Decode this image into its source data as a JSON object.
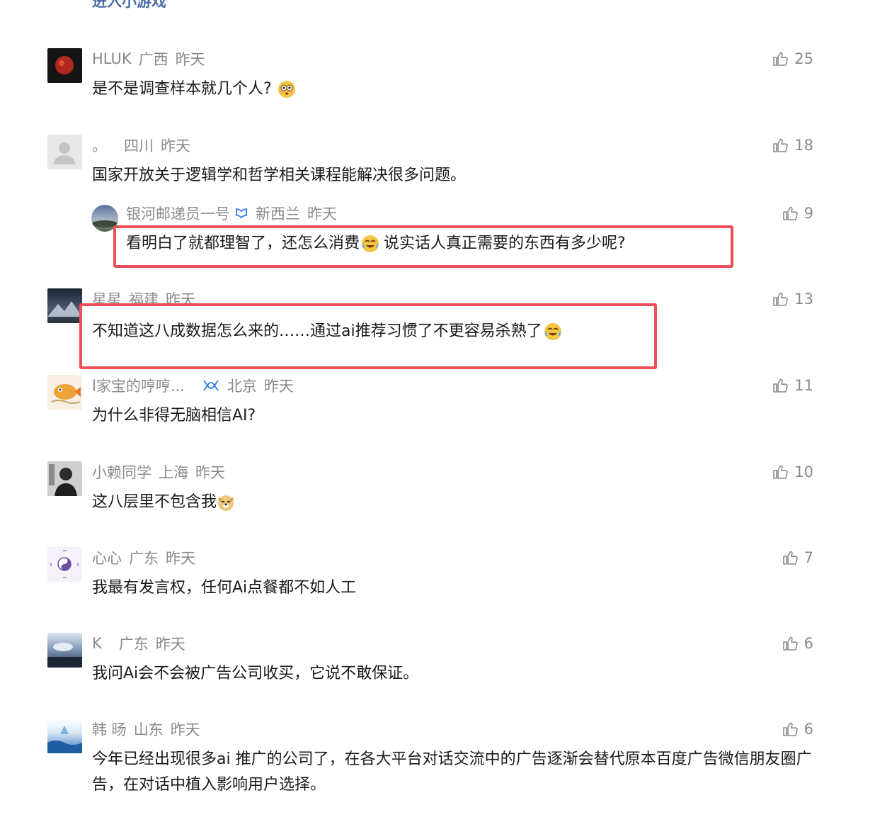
{
  "top_link": "进入小游戏",
  "comments": [
    {
      "user": "HLUK",
      "location": "广西",
      "time": "昨天",
      "likes": "25",
      "text": "是不是调查样本就几个人?",
      "emoji": "flushed"
    },
    {
      "user": "。",
      "location": "四川",
      "time": "昨天",
      "likes": "18",
      "text": "国家开放关于逻辑学和哲学相关课程能解决很多问题。"
    },
    {
      "user": "银河邮递员一号",
      "location": "新西兰",
      "time": "昨天",
      "likes": "9",
      "text_a": "看明白了就都理智了，还怎么消费",
      "text_b": "说实话人真正需要的东西有多少呢?",
      "emoji": "laugh-cry"
    },
    {
      "user": "星星",
      "location": "福建",
      "time": "昨天",
      "likes": "13",
      "text": "不知道这八成数据怎么来的……通过ai推荐习惯了不更容易杀熟了",
      "emoji": "laugh-cry"
    },
    {
      "user": "l家宝的哼哼...",
      "location": "北京",
      "time": "昨天",
      "likes": "11",
      "text": "为什么非得无脑相信AI?"
    },
    {
      "user": "小赖同学",
      "location": "上海",
      "time": "昨天",
      "likes": "10",
      "text": "这八层里不包含我",
      "emoji": "doge"
    },
    {
      "user": "心心",
      "location": "广东",
      "time": "昨天",
      "likes": "7",
      "text": "我最有发言权，任何Ai点餐都不如人工"
    },
    {
      "user": "K",
      "location": "广东",
      "time": "昨天",
      "likes": "6",
      "text": "我问Ai会不会被广告公司收买，它说不敢保证。"
    },
    {
      "user": "韩 旸",
      "location": "山东",
      "time": "昨天",
      "likes": "6",
      "text": "今年已经出现很多ai 推广的公司了，在各大平台对话交流中的广告逐渐会替代原本百度广告微信朋友圈广告，在对话中植入影响用户选择。"
    }
  ],
  "colors": {
    "highlight": "#ef4f56",
    "meta": "#8a8a8a",
    "link": "#4a6da7"
  }
}
